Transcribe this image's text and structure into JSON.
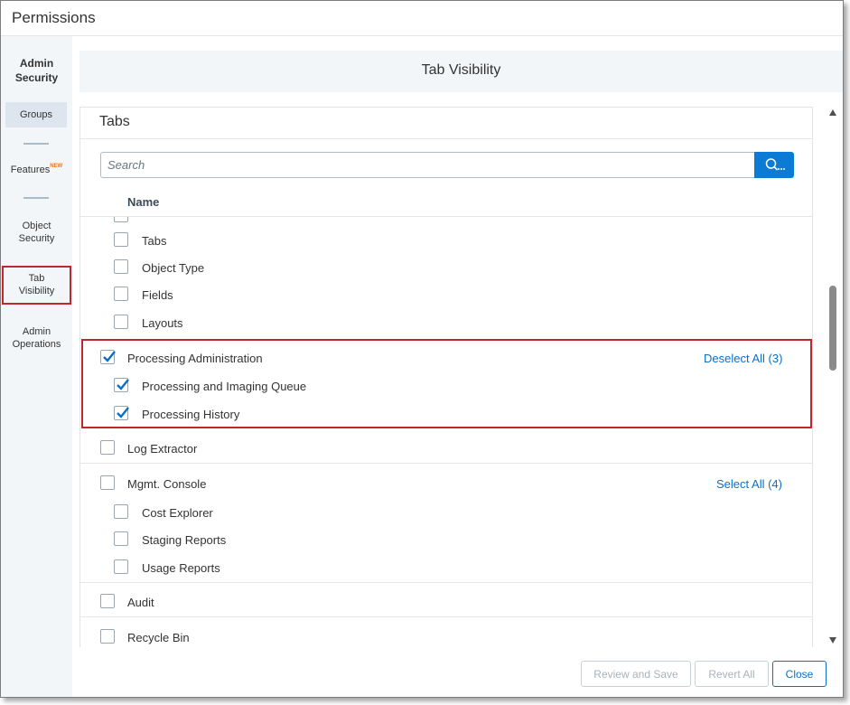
{
  "window": {
    "title": "Permissions"
  },
  "left_nav": {
    "header": "Admin Security",
    "items": [
      {
        "label": "Groups"
      },
      {
        "label": "Features",
        "badge": "NEW"
      },
      {
        "label": "Object Security"
      },
      {
        "label": "Tab Visibility"
      },
      {
        "label": "Admin Operations"
      }
    ]
  },
  "main": {
    "header_title": "Tab Visibility",
    "panel_title": "Tabs",
    "search": {
      "placeholder": "Search",
      "button_icon": "search-icon"
    },
    "column_header": "Name",
    "rows": [
      {
        "label": "Tabs",
        "checked": false,
        "indent": true
      },
      {
        "label": "Object Type",
        "checked": false,
        "indent": true
      },
      {
        "label": "Fields",
        "checked": false,
        "indent": true
      },
      {
        "label": "Layouts",
        "checked": false,
        "indent": true
      },
      {
        "label": "Processing Administration",
        "checked": true,
        "indent": false,
        "action": "Deselect All (3)"
      },
      {
        "label": "Processing and Imaging Queue",
        "checked": true,
        "indent": true
      },
      {
        "label": "Processing History",
        "checked": true,
        "indent": true
      },
      {
        "label": "Log Extractor",
        "checked": false,
        "indent": false
      },
      {
        "label": "Mgmt. Console",
        "checked": false,
        "indent": false,
        "action": "Select All (4)"
      },
      {
        "label": "Cost Explorer",
        "checked": false,
        "indent": true
      },
      {
        "label": "Staging Reports",
        "checked": false,
        "indent": true
      },
      {
        "label": "Usage Reports",
        "checked": false,
        "indent": true
      },
      {
        "label": "Audit",
        "checked": false,
        "indent": false
      },
      {
        "label": "Recycle Bin",
        "checked": false,
        "indent": false
      }
    ]
  },
  "footer": {
    "review_save": "Review and Save",
    "revert_all": "Revert All",
    "close": "Close"
  },
  "colors": {
    "accent": "#0b7bd6",
    "highlight": "#c0272d",
    "link": "#0b6fc7"
  }
}
